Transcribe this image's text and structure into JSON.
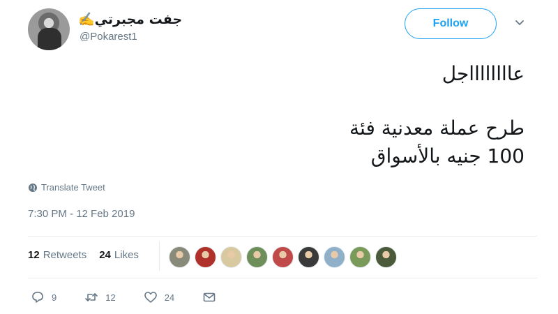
{
  "user": {
    "display_name": "✍️جفت مجبرتي",
    "handle": "@Pokarest1"
  },
  "follow_label": "Follow",
  "tweet": {
    "lines": [
      "عااااااااجل",
      "طرح عملة معدنية فئة",
      "100 جنيه بالأسواق"
    ]
  },
  "translate_label": "Translate Tweet",
  "timestamp": "7:30 PM - 12 Feb 2019",
  "stats": {
    "retweets_count": "12",
    "retweets_label": "Retweets",
    "likes_count": "24",
    "likes_label": "Likes"
  },
  "liker_avatar_colors": [
    "#8a8a7a",
    "#b0302a",
    "#d8c9a0",
    "#6f8f5a",
    "#c04a4a",
    "#3a3a3a",
    "#8fb0c8",
    "#7a9a5a",
    "#4a5a3a"
  ],
  "actions": {
    "reply_count": "9",
    "retweet_count": "12",
    "like_count": "24"
  },
  "colors": {
    "accent": "#1da1f2",
    "secondary_text": "#657786",
    "primary_text": "#14171a"
  }
}
